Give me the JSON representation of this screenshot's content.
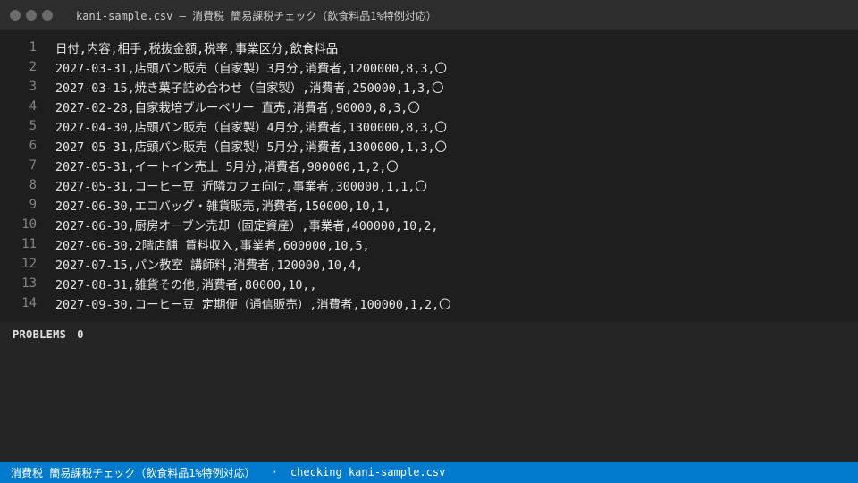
{
  "window": {
    "title": "kani-sample.csv — 消費税 簡易課税チェック（飲食料品1%特例対応）"
  },
  "editor": {
    "lines": [
      {
        "n": "1",
        "text": "日付,内容,相手,税抜金額,税率,事業区分,飲食料品"
      },
      {
        "n": "2",
        "text": "2027-03-31,店頭パン販売（自家製）3月分,消費者,1200000,8,3,〇"
      },
      {
        "n": "3",
        "text": "2027-03-15,焼き菓子詰め合わせ（自家製）,消費者,250000,1,3,〇"
      },
      {
        "n": "4",
        "text": "2027-02-28,自家栽培ブルーベリー 直売,消費者,90000,8,3,〇"
      },
      {
        "n": "5",
        "text": "2027-04-30,店頭パン販売（自家製）4月分,消費者,1300000,8,3,〇"
      },
      {
        "n": "6",
        "text": "2027-05-31,店頭パン販売（自家製）5月分,消費者,1300000,1,3,〇"
      },
      {
        "n": "7",
        "text": "2027-05-31,イートイン売上 5月分,消費者,900000,1,2,〇"
      },
      {
        "n": "8",
        "text": "2027-05-31,コーヒー豆 近隣カフェ向け,事業者,300000,1,1,〇"
      },
      {
        "n": "9",
        "text": "2027-06-30,エコバッグ・雑貨販売,消費者,150000,10,1,"
      },
      {
        "n": "10",
        "text": "2027-06-30,厨房オーブン売却（固定資産）,事業者,400000,10,2,"
      },
      {
        "n": "11",
        "text": "2027-06-30,2階店舗 賃料収入,事業者,600000,10,5,"
      },
      {
        "n": "12",
        "text": "2027-07-15,パン教室 講師料,消費者,120000,10,4,"
      },
      {
        "n": "13",
        "text": "2027-08-31,雑貨その他,消費者,80000,10,,"
      },
      {
        "n": "14",
        "text": "2027-09-30,コーヒー豆 定期便（通信販売）,消費者,100000,1,2,〇"
      }
    ]
  },
  "panel": {
    "problems_label": "PROBLEMS",
    "problems_count": "0"
  },
  "statusbar": {
    "left": "消費税 簡易課税チェック（飲食料品1%特例対応）",
    "separator": "·",
    "right": "checking kani-sample.csv"
  }
}
